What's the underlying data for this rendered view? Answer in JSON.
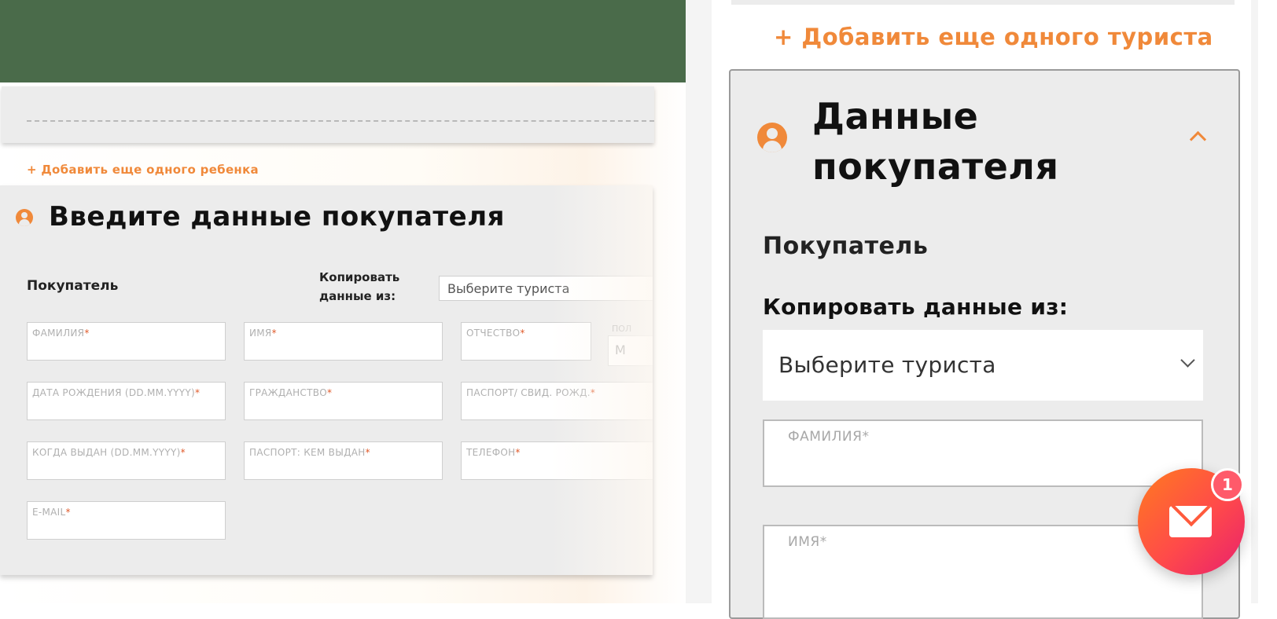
{
  "left": {
    "add_child_link": "+ Добавить еще одного ребенка",
    "buyer_title": "Введите данные покупателя",
    "buyer_label": "Покупатель",
    "copy_label": "Копировать данные из:",
    "select_placeholder": "Выберите туриста",
    "pol_label": "ПОЛ",
    "pol_value": "М",
    "fields": [
      {
        "label": "ФАМИЛИЯ"
      },
      {
        "label": "ИМЯ"
      },
      {
        "label": "ОТЧЕСТВО"
      },
      {
        "label": "ДАТА РОЖДЕНИЯ (DD.MM.YYYY)"
      },
      {
        "label": "ГРАЖДАНСТВО"
      },
      {
        "label": "ПАСПОРТ/ СВИД. РОЖД."
      },
      {
        "label": "КОГДА ВЫДАН (DD.MM.YYYY)"
      },
      {
        "label": "ПАСПОРТ: КЕМ ВЫДАН"
      },
      {
        "label": "ТЕЛЕФОН"
      },
      {
        "label": "E-MAIL"
      }
    ],
    "required_mark": "*"
  },
  "mobile": {
    "add_tourist_link": "+ Добавить еще одного туриста",
    "section_title": "Данные покупателя",
    "buyer_label": "Покупатель",
    "copy_label": "Копировать данные из:",
    "select_placeholder": "Выберите туриста",
    "fields": [
      {
        "label": "ФАМИЛИЯ*"
      },
      {
        "label": "ИМЯ*"
      }
    ]
  },
  "chat": {
    "badge_count": "1"
  },
  "colors": {
    "accent": "#f0893a",
    "card_bg": "#ececec",
    "header_green": "#4a6b4a"
  },
  "icons": [
    "user-icon",
    "chevron-up-icon",
    "chevron-down-icon",
    "envelope-icon"
  ]
}
